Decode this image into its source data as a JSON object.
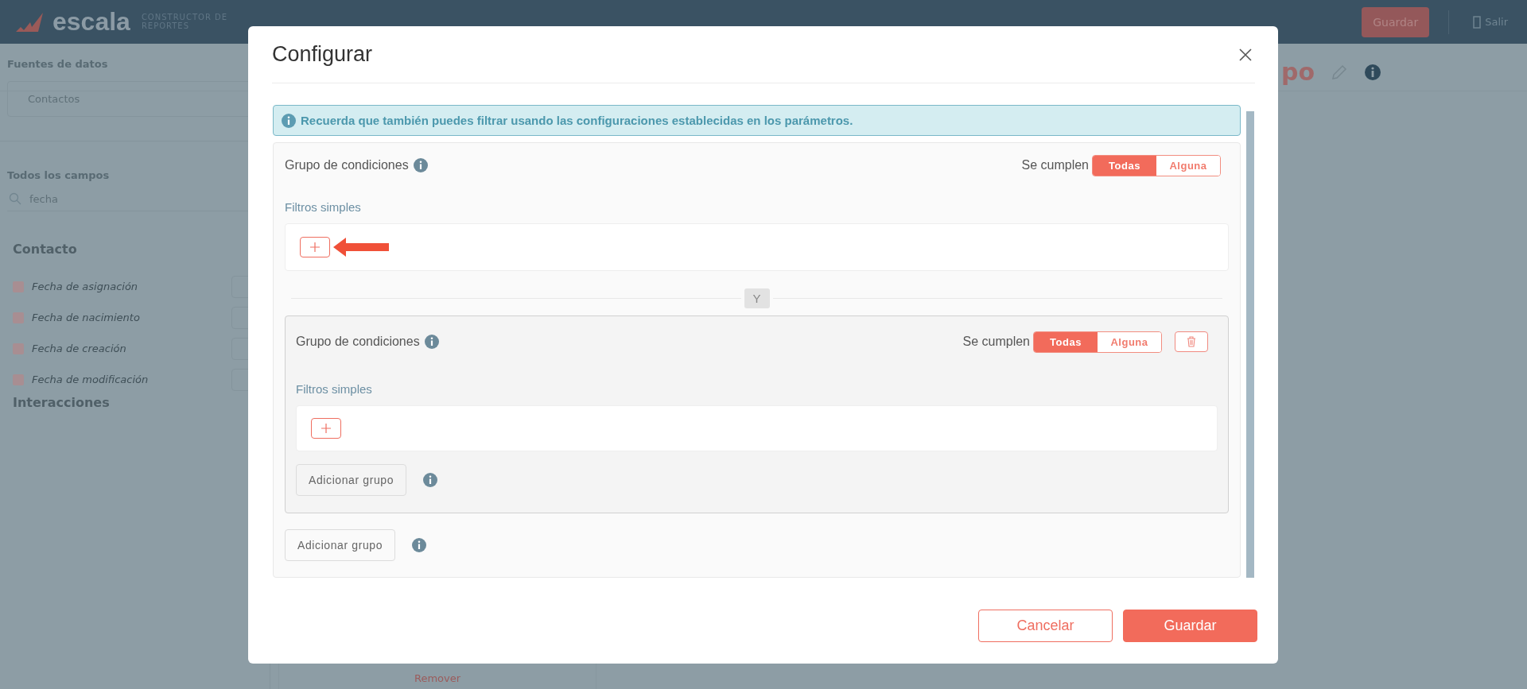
{
  "app_header": {
    "logo": "escala",
    "subtitle": "CONSTRUCTOR DE REPORTES",
    "save_button": "Guardar",
    "exit_button": "Salir"
  },
  "sidebar": {
    "data_sources_label": "Fuentes de datos",
    "data_source": "Contactos",
    "fields_label": "Todos los campos",
    "search_value": "fecha",
    "sections": [
      {
        "title": "Contacto",
        "fields": [
          "Fecha de asignación",
          "Fecha de nacimiento",
          "Fecha de creación",
          "Fecha de modificación"
        ]
      },
      {
        "title": "Interacciones"
      }
    ]
  },
  "page_title_fragment": "po",
  "remove_link": "Remover",
  "dialog": {
    "title": "Configurar",
    "notice": "Recuerda que también puedes filtrar usando las configuraciones establecidas en los parámetros.",
    "condition_group": {
      "title": "Grupo de condiciones",
      "match_label": "Se cumplen",
      "match_options": [
        {
          "label": "Todas",
          "selected": true
        },
        {
          "label": "Alguna",
          "selected": false
        }
      ],
      "filters_label": "Filtros simples",
      "connector": "Y",
      "add_group_button": "Adicionar grupo",
      "subgroups": [
        {
          "title": "Grupo de condiciones",
          "match_label": "Se cumplen",
          "deletable": true,
          "match_options": [
            {
              "label": "Todas",
              "selected": true
            },
            {
              "label": "Alguna",
              "selected": false
            }
          ],
          "filters_label": "Filtros simples",
          "add_group_button": "Adicionar grupo"
        }
      ]
    },
    "buttons": [
      {
        "label": "Cancelar",
        "kind": "secondary"
      },
      {
        "label": "Guardar",
        "kind": "primary"
      }
    ]
  }
}
